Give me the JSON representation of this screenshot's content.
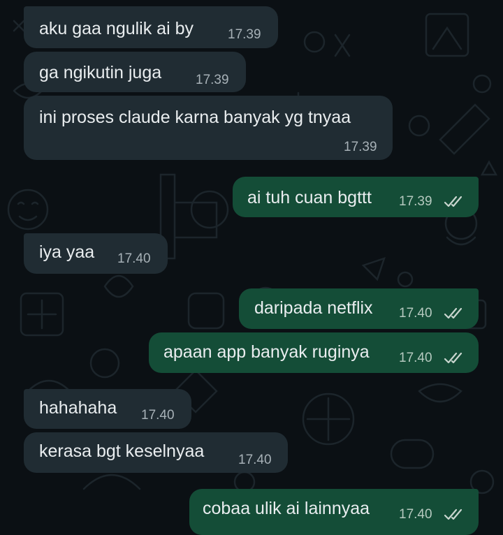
{
  "theme": {
    "background": "#0b1014",
    "incoming_bubble": "#202c33",
    "outgoing_bubble": "#144d37",
    "text": "#e9edef",
    "timestamp": "#a7b1b7",
    "read_tick": "#c9d6cf"
  },
  "messages": [
    {
      "direction": "incoming",
      "text": "aku gaa ngulik ai by",
      "time": "17.39"
    },
    {
      "direction": "incoming",
      "text": "ga ngikutin juga",
      "time": "17.39"
    },
    {
      "direction": "incoming",
      "text": "ini proses claude karna banyak yg tnyaa",
      "time": "17.39"
    },
    {
      "direction": "outgoing",
      "text": "ai tuh cuan bgttt",
      "time": "17.39",
      "status_icon": "double-check-icon"
    },
    {
      "direction": "incoming",
      "text": "iya yaa",
      "time": "17.40"
    },
    {
      "direction": "outgoing",
      "text": "daripada netflix",
      "time": "17.40",
      "status_icon": "double-check-icon"
    },
    {
      "direction": "outgoing",
      "text": "apaan app banyak ruginya",
      "time": "17.40",
      "status_icon": "double-check-icon"
    },
    {
      "direction": "incoming",
      "text": "hahahaha",
      "time": "17.40"
    },
    {
      "direction": "incoming",
      "text": "kerasa bgt keselnyaa",
      "time": "17.40"
    },
    {
      "direction": "outgoing",
      "text": "cobaa ulik ai lainnyaa",
      "time": "17.40",
      "status_icon": "double-check-icon"
    }
  ]
}
